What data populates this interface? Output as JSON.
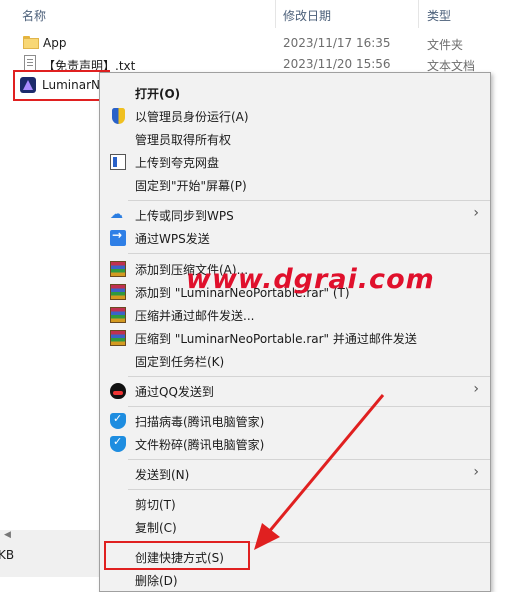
{
  "columns": {
    "name": "名称",
    "date": "修改日期",
    "type": "类型"
  },
  "files": [
    {
      "name": "App",
      "date": "2023/11/17 16:35",
      "type": "文件夹",
      "icon": "folder-icon"
    },
    {
      "name": "【免责声明】.txt",
      "date": "2023/11/20 15:56",
      "type": "文本文档",
      "icon": "text-file-icon"
    }
  ],
  "selected_file": {
    "name": "LuminarN",
    "icon": "luminar-app-icon"
  },
  "context_menu": {
    "open": "打开(O)",
    "run_as_admin": "以管理员身份运行(A)",
    "take_ownership": "管理员取得所有权",
    "upload_quark": "上传到夸克网盘",
    "pin_start": "固定到\"开始\"屏幕(P)",
    "upload_wps": "上传或同步到WPS",
    "send_wps": "通过WPS发送",
    "add_archive": "添加到压缩文件(A)...",
    "add_named_archive": "添加到 \"LuminarNeoPortable.rar\" (T)",
    "compress_email": "压缩并通过邮件发送...",
    "compress_named_email": "压缩到 \"LuminarNeoPortable.rar\" 并通过邮件发送",
    "pin_taskbar": "固定到任务栏(K)",
    "send_qq": "通过QQ发送到",
    "scan_virus": "扫描病毒(腾讯电脑管家)",
    "shred": "文件粉碎(腾讯电脑管家)",
    "send_to": "发送到(N)",
    "cut": "剪切(T)",
    "copy": "复制(C)",
    "create_shortcut": "创建快捷方式(S)",
    "delete": "删除(D)"
  },
  "watermark": "www.dgrai.com",
  "status_bar": {
    "size_fragment": "KB"
  },
  "colors": {
    "annotation_red": "#e02020",
    "menu_bg": "#f2f2f2",
    "watermark_red": "#e0102c"
  }
}
